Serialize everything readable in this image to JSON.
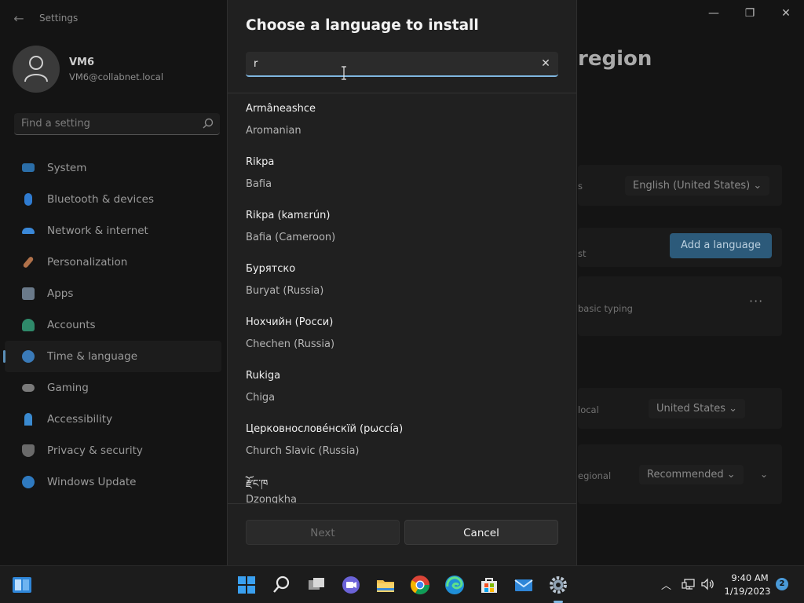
{
  "window": {
    "app_title": "Settings",
    "back_icon": "back-arrow-icon"
  },
  "user": {
    "name": "VM6",
    "email": "VM6@collabnet.local"
  },
  "search": {
    "placeholder": "Find a setting"
  },
  "nav": [
    {
      "label": "System",
      "color": "#2b6ea8"
    },
    {
      "label": "Bluetooth & devices",
      "color": "#2f7bd0"
    },
    {
      "label": "Network & internet",
      "color": "#3a88d8"
    },
    {
      "label": "Personalization",
      "color": "#b0714a"
    },
    {
      "label": "Apps",
      "color": "#6a7a8a"
    },
    {
      "label": "Accounts",
      "color": "#2f8a6a"
    },
    {
      "label": "Time & language",
      "color": "#3a7ab8"
    },
    {
      "label": "Gaming",
      "color": "#7a7a7a"
    },
    {
      "label": "Accessibility",
      "color": "#3a8ad0"
    },
    {
      "label": "Privacy & security",
      "color": "#6a6a6a"
    },
    {
      "label": "Windows Update",
      "color": "#2f7ac0"
    }
  ],
  "background": {
    "title_fragment": "region",
    "display_language_fragment": "s",
    "display_language_value": "English (United States)",
    "add_language_label": "Add a language",
    "list_fragment": "st",
    "typing_fragment": "basic typing",
    "country_fragment": "local",
    "country_value": "United States",
    "format_fragment": "egional",
    "format_value": "Recommended"
  },
  "dialog": {
    "title": "Choose a language to install",
    "search_value": "r",
    "languages": [
      {
        "native": "Armâneashce",
        "english": "Aromanian"
      },
      {
        "native": "Rikpa",
        "english": "Bafia"
      },
      {
        "native": "Rikpa (kamɛrún)",
        "english": "Bafia (Cameroon)"
      },
      {
        "native": "Бурятско",
        "english": "Buryat (Russia)"
      },
      {
        "native": "Нохчийн (Росси)",
        "english": "Chechen (Russia)"
      },
      {
        "native": "Rukiga",
        "english": "Chiga"
      },
      {
        "native": "Церковнослове́нскїй (рѡссі́а)",
        "english": "Church Slavic (Russia)"
      },
      {
        "native": "རྫོང་ཁ",
        "english": "Dzongkha"
      }
    ],
    "next_label": "Next",
    "cancel_label": "Cancel"
  },
  "taskbar": {
    "time": "9:40 AM",
    "date": "1/19/2023",
    "notification_count": "2"
  }
}
